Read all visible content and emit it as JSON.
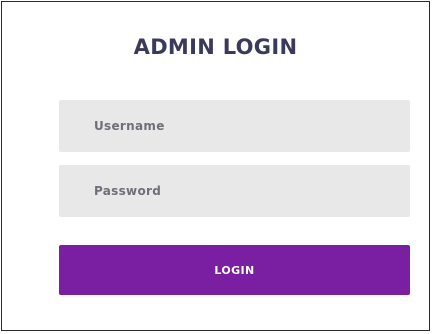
{
  "login": {
    "title": "ADMIN LOGIN",
    "username": {
      "placeholder": "Username",
      "value": ""
    },
    "password": {
      "placeholder": "Password",
      "value": ""
    },
    "submit_label": "LOGIN"
  },
  "colors": {
    "title": "#3b3a5a",
    "field_background": "#e8e8e8",
    "placeholder": "#6f6f7a",
    "button_background": "#7a1fa2",
    "button_text": "#ffffff",
    "card_border": "#2b2b2b"
  }
}
